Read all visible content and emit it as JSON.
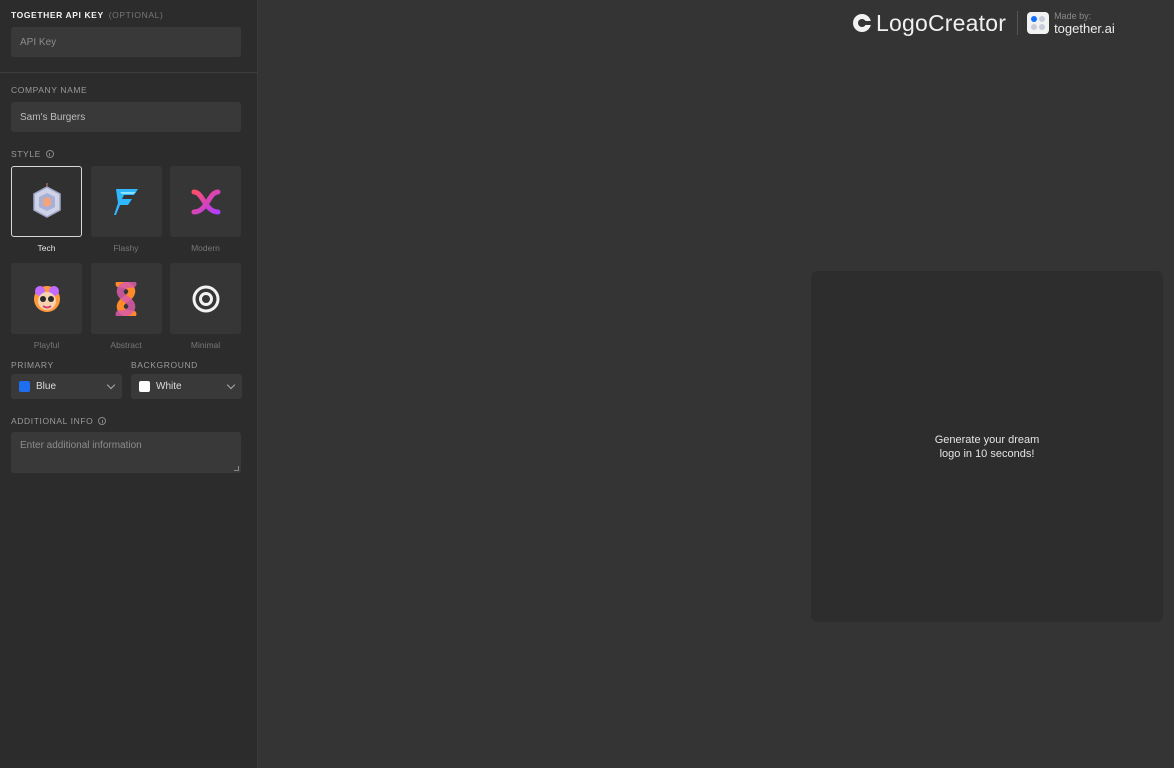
{
  "sidebar": {
    "api_key": {
      "label": "TOGETHER API KEY",
      "optional": "(OPTIONAL)",
      "placeholder": "API Key"
    },
    "company": {
      "label": "COMPANY NAME",
      "value": "Sam's Burgers"
    },
    "style": {
      "label": "STYLE",
      "options": [
        {
          "name": "Tech",
          "icon": "tech-logo-icon",
          "selected": true
        },
        {
          "name": "Flashy",
          "icon": "flashy-logo-icon",
          "selected": false
        },
        {
          "name": "Modern",
          "icon": "modern-logo-icon",
          "selected": false
        },
        {
          "name": "Playful",
          "icon": "playful-logo-icon",
          "selected": false
        },
        {
          "name": "Abstract",
          "icon": "abstract-logo-icon",
          "selected": false
        },
        {
          "name": "Minimal",
          "icon": "minimal-logo-icon",
          "selected": false
        }
      ]
    },
    "primary": {
      "label": "PRIMARY",
      "value": "Blue",
      "color": "#1e6ef0"
    },
    "background": {
      "label": "BACKGROUND",
      "value": "White",
      "color": "#ffffff"
    },
    "additional": {
      "label": "ADDITIONAL INFO",
      "placeholder": "Enter additional information"
    }
  },
  "header": {
    "brand": "LogoCreator",
    "made_by": "Made by:",
    "company": "together.ai"
  },
  "preview": {
    "message": "Generate your dream logo in 10 seconds!"
  },
  "colors": {
    "sidebar_bg": "#2c2c2c",
    "main_bg": "#343434",
    "input_bg": "#393939"
  }
}
